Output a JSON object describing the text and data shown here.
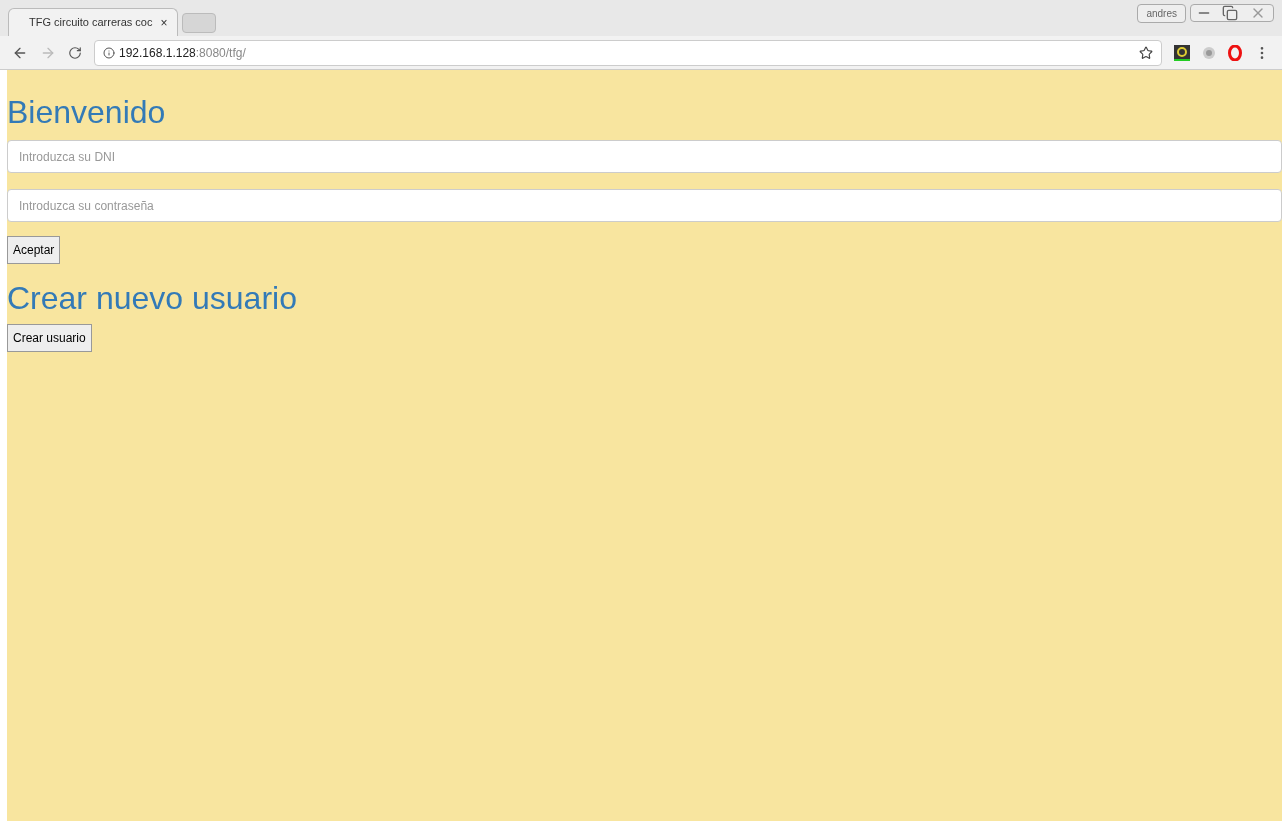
{
  "browser": {
    "tabs": [
      {
        "title": "TFG circuito carreras coc",
        "close": "×",
        "selected": true
      }
    ],
    "user": "andres",
    "address": {
      "host": "192.168.1.128",
      "path": ":8080/tfg/"
    }
  },
  "page": {
    "title": "Bienvenido",
    "fields": [
      {
        "placeholder": "Introduzca su DNI"
      },
      {
        "placeholder": "Introduzca su contraseña"
      }
    ],
    "submit": "Aceptar",
    "section_title": "Crear nuevo usuario",
    "create_button": "Crear usuario"
  }
}
